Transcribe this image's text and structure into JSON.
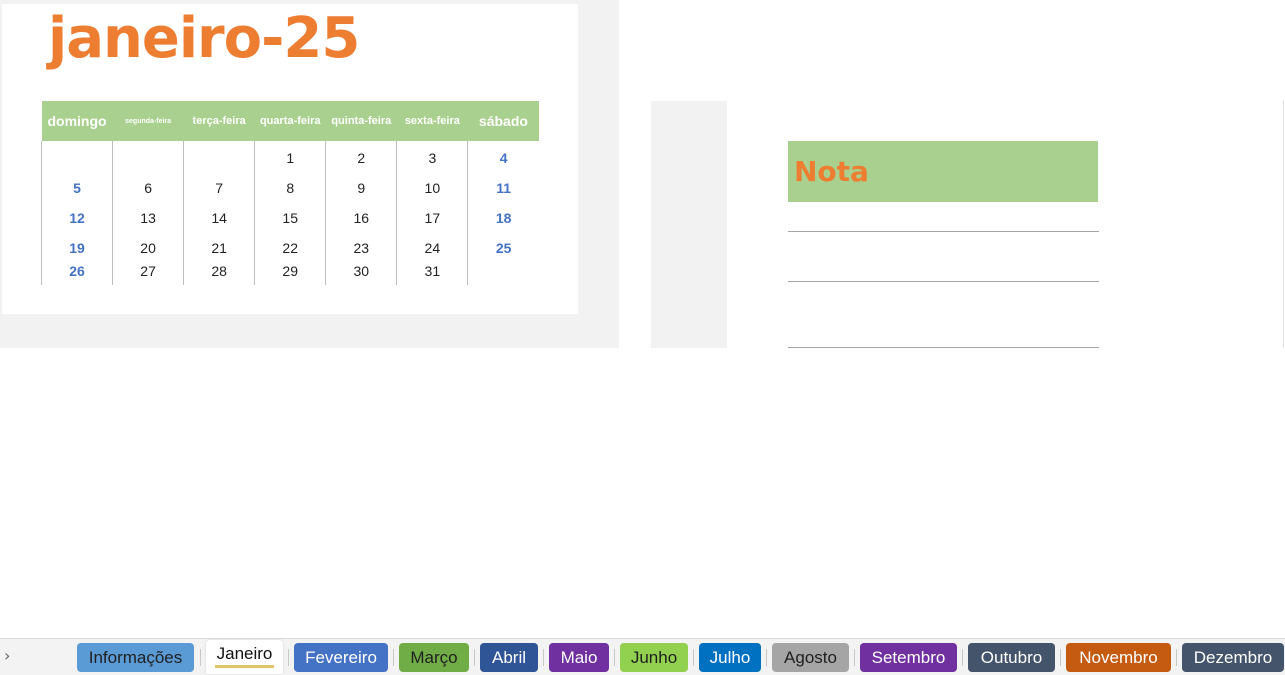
{
  "calendar": {
    "month_title": "janeiro-25",
    "weekdays": [
      "domingo",
      "segunda-feira",
      "terça-feira",
      "quarta-feira",
      "quinta-feira",
      "sexta-feira",
      "sábado"
    ],
    "weeks": [
      [
        "",
        "",
        "",
        "1",
        "2",
        "3",
        "4"
      ],
      [
        "5",
        "6",
        "7",
        "8",
        "9",
        "10",
        "11"
      ],
      [
        "12",
        "13",
        "14",
        "15",
        "16",
        "17",
        "18"
      ],
      [
        "19",
        "20",
        "21",
        "22",
        "23",
        "24",
        "25"
      ],
      [
        "26",
        "27",
        "28",
        "29",
        "30",
        "31",
        ""
      ]
    ]
  },
  "note": {
    "title": "Nota"
  },
  "tabs": [
    {
      "label": "Informações",
      "color": "#5b9bd5",
      "text_color": "#1f1f1f"
    },
    {
      "label": "Janeiro",
      "color": "#ffffff",
      "text_color": "#111111",
      "active": true
    },
    {
      "label": "Fevereiro",
      "color": "#4472c4",
      "text_color": "#ffffff"
    },
    {
      "label": "Março",
      "color": "#70ad47",
      "text_color": "#1f1f1f"
    },
    {
      "label": "Abril",
      "color": "#2f5597",
      "text_color": "#ffffff"
    },
    {
      "label": "Maio",
      "color": "#7030a0",
      "text_color": "#ffffff"
    },
    {
      "label": "Junho",
      "color": "#92d050",
      "text_color": "#1f1f1f"
    },
    {
      "label": "Julho",
      "color": "#0070c0",
      "text_color": "#ffffff"
    },
    {
      "label": "Agosto",
      "color": "#a5a5a5",
      "text_color": "#1f1f1f"
    },
    {
      "label": "Setembro",
      "color": "#7030a0",
      "text_color": "#ffffff"
    },
    {
      "label": "Outubro",
      "color": "#44546a",
      "text_color": "#ffffff"
    },
    {
      "label": "Novembro",
      "color": "#c55a11",
      "text_color": "#ffffff"
    },
    {
      "label": "Dezembro",
      "color": "#44546a",
      "text_color": "#ffffff"
    }
  ],
  "colors": {
    "accent_orange": "#ed7d31",
    "header_green": "#a9d08e",
    "weekend_blue": "#4472c4"
  }
}
